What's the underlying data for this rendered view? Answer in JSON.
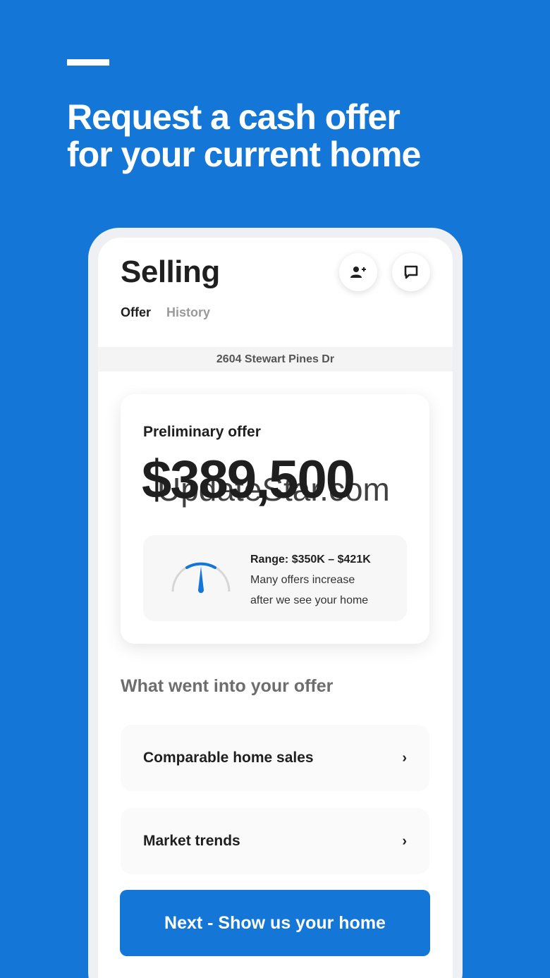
{
  "promo": {
    "headline_line1": "Request a cash offer",
    "headline_line2": "for your current home"
  },
  "screen": {
    "title": "Selling",
    "header_icons": [
      "add-person-icon",
      "chat-icon"
    ],
    "tabs": [
      {
        "label": "Offer",
        "active": true
      },
      {
        "label": "History",
        "active": false
      }
    ],
    "address": "2604 Stewart Pines Dr",
    "offer": {
      "label": "Preliminary offer",
      "amount": "$389,500",
      "watermark": "UpdateStar.com",
      "range_label": "Range:",
      "range_value": "$350K – $421K",
      "note_line1": "Many offers increase",
      "note_line2": "after we see your home"
    },
    "section_title": "What went into your offer",
    "rows": [
      {
        "label": "Comparable home sales"
      },
      {
        "label": "Market trends"
      }
    ],
    "cta_label": "Next - Show us your home"
  },
  "colors": {
    "brand_blue": "#1476d6",
    "text_dark": "#1f1f1f",
    "text_muted": "#9a9a9a"
  }
}
